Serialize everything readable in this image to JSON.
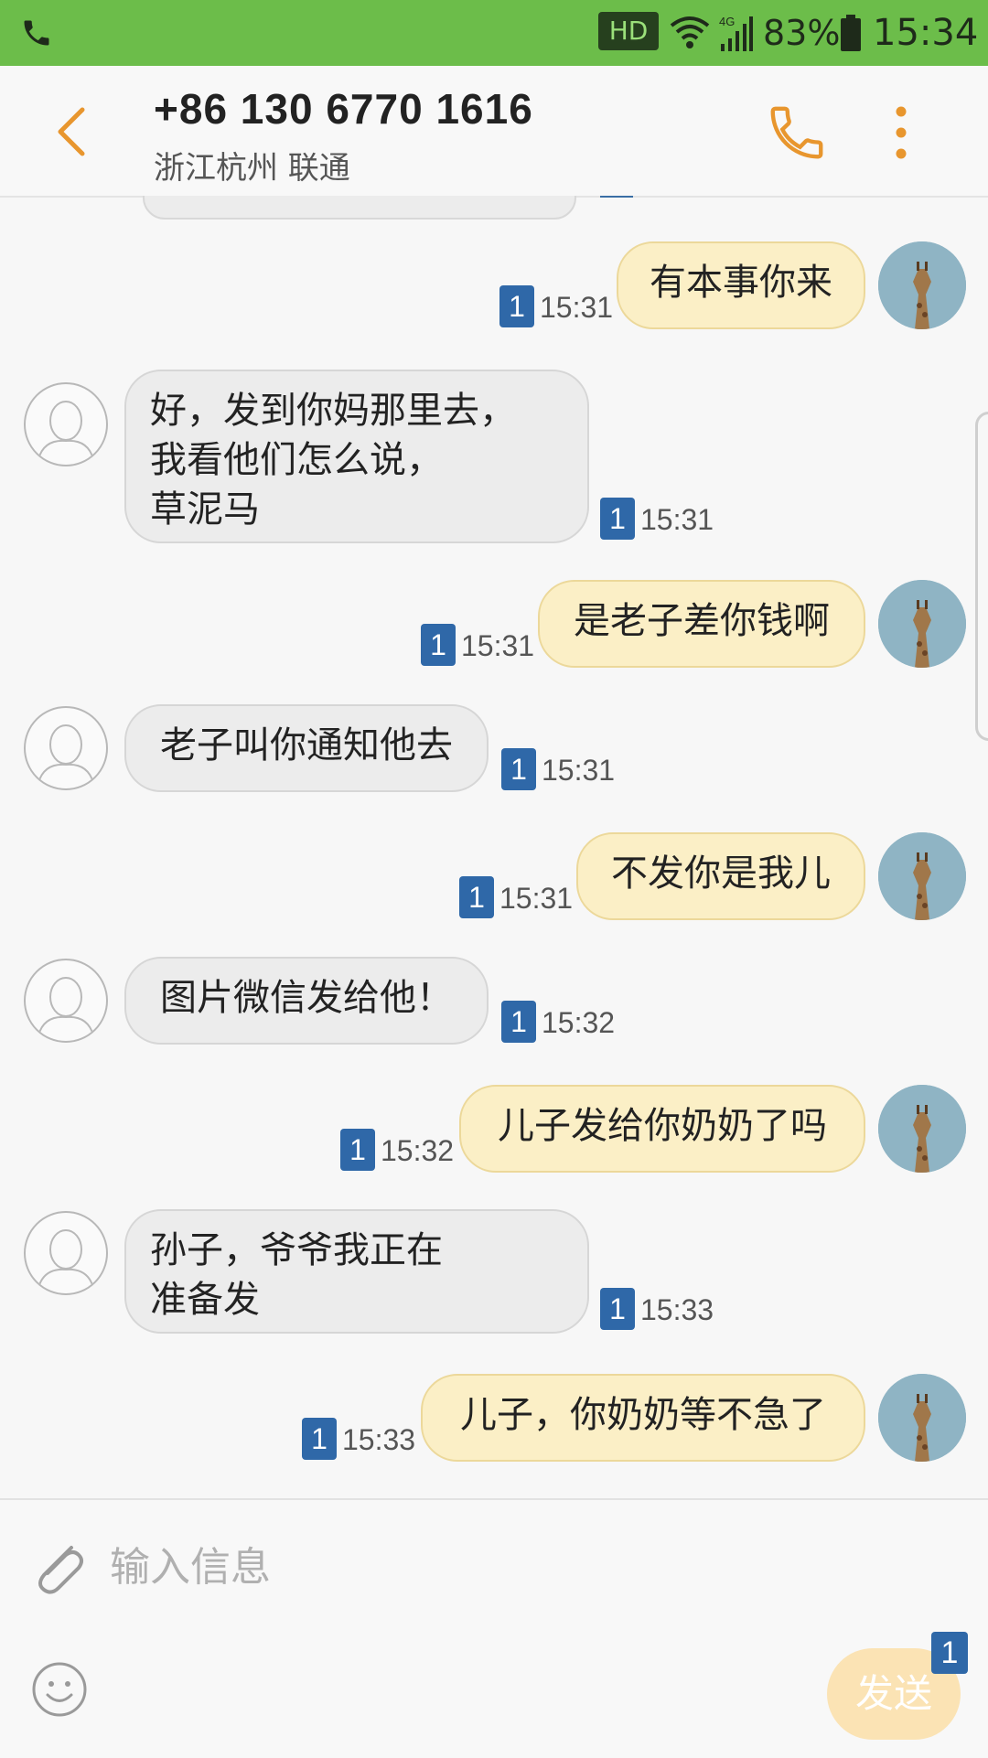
{
  "status_bar": {
    "network_type": "HD",
    "signal_label": "4G",
    "battery": "83%",
    "time": "15:34",
    "background": "#6cbd4a"
  },
  "header": {
    "contact_number": "+86 130 6770 1616",
    "contact_location": "浙江杭州 联通",
    "accent": "#e8962e"
  },
  "messages": [
    {
      "direction": "out",
      "text": "有本事你来",
      "sim": "1",
      "time": "15:31"
    },
    {
      "direction": "in",
      "text": "好，发到你妈那里去，\n我看他们怎么说，\n草泥马",
      "sim": "1",
      "time": "15:31"
    },
    {
      "direction": "out",
      "text": "是老子差你钱啊",
      "sim": "1",
      "time": "15:31"
    },
    {
      "direction": "in",
      "text": "老子叫你通知他去",
      "sim": "1",
      "time": "15:31"
    },
    {
      "direction": "out",
      "text": "不发你是我儿",
      "sim": "1",
      "time": "15:31"
    },
    {
      "direction": "in",
      "text": "图片微信发给他！",
      "sim": "1",
      "time": "15:32"
    },
    {
      "direction": "out",
      "text": "儿子发给你奶奶了吗",
      "sim": "1",
      "time": "15:32"
    },
    {
      "direction": "in",
      "text": "孙子，爷爷我正在\n准备发",
      "sim": "1",
      "time": "15:33"
    },
    {
      "direction": "out",
      "text": "儿子，你奶奶等不急了",
      "sim": "1",
      "time": "15:33"
    }
  ],
  "composer": {
    "placeholder": "输入信息",
    "send_label": "发送",
    "send_sim": "1"
  }
}
